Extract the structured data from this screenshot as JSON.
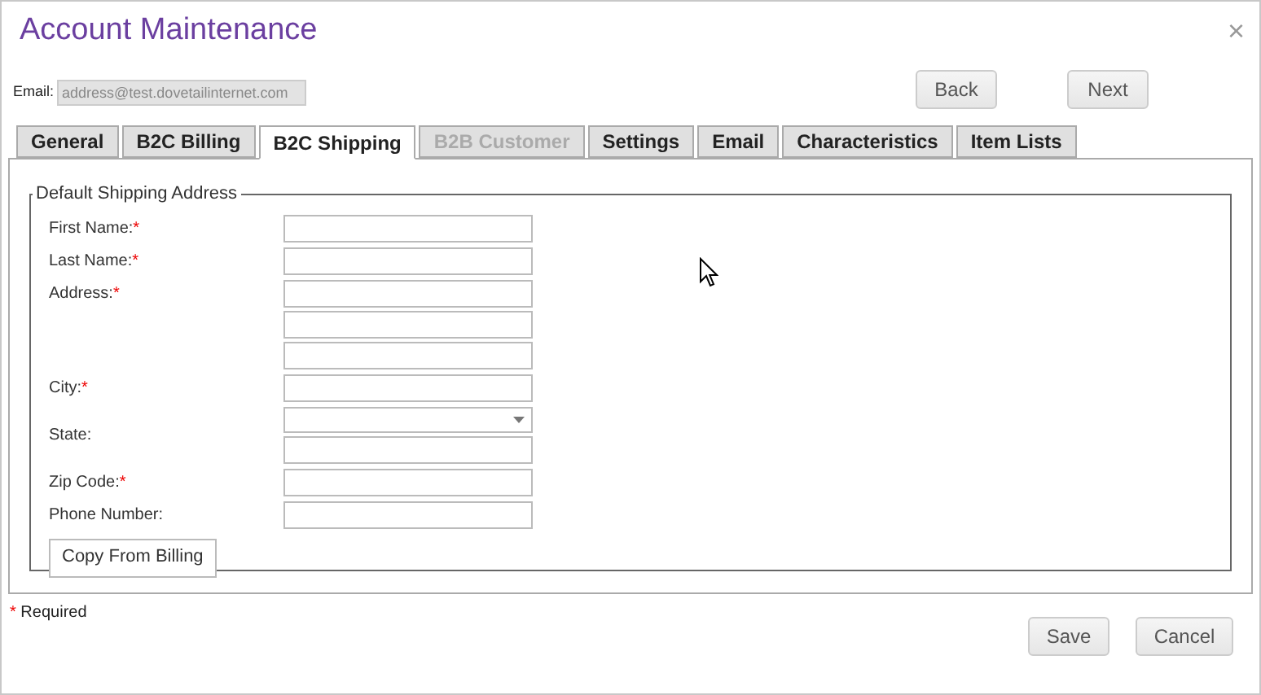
{
  "window": {
    "title": "Account Maintenance",
    "close": "×"
  },
  "email": {
    "label": "Email:",
    "value": "address@test.dovetailinternet.com",
    "disabled": true
  },
  "nav_buttons": [
    "Back",
    "Next"
  ],
  "tabs": [
    {
      "label": "General",
      "selected": false,
      "disabled": false
    },
    {
      "label": "B2C Billing",
      "selected": false,
      "disabled": false
    },
    {
      "label": "B2C Shipping",
      "selected": true,
      "disabled": false
    },
    {
      "label": "B2B Customer",
      "selected": false,
      "disabled": true
    },
    {
      "label": "Settings",
      "selected": false,
      "disabled": false
    },
    {
      "label": "Email",
      "selected": false,
      "disabled": false
    },
    {
      "label": "Characteristics",
      "selected": false,
      "disabled": false
    },
    {
      "label": "Item Lists",
      "selected": false,
      "disabled": false
    }
  ],
  "fieldset": {
    "legend": "Default Shipping Address",
    "fields": [
      {
        "label": "First Name:",
        "required_mark": "*",
        "inputs": [
          {
            "kind": "text"
          }
        ]
      },
      {
        "label": "Last Name:",
        "required_mark": "*",
        "inputs": [
          {
            "kind": "text"
          }
        ]
      },
      {
        "label": "Address:",
        "required_mark": "*",
        "inputs": [
          {
            "kind": "text"
          },
          {
            "kind": "text"
          },
          {
            "kind": "text"
          }
        ]
      },
      {
        "label": "City:",
        "required_mark": "*",
        "inputs": [
          {
            "kind": "text"
          }
        ]
      },
      {
        "label": "State:",
        "inputs": [
          {
            "kind": "dropdown"
          },
          {
            "kind": "text"
          }
        ]
      },
      {
        "label": "Zip Code:",
        "required_mark": "*",
        "inputs": [
          {
            "kind": "text"
          }
        ]
      },
      {
        "label": "Phone Number:",
        "inputs": [
          {
            "kind": "text"
          }
        ]
      }
    ],
    "copy_button": "Copy From Billing"
  },
  "required_note": {
    "mark": "*",
    "text": "Required"
  },
  "footer_buttons": [
    "Save",
    "Cancel"
  ]
}
